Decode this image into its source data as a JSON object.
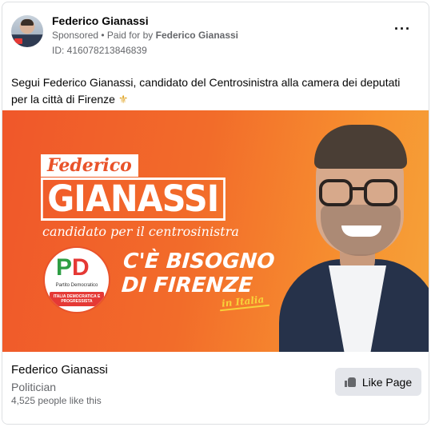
{
  "post": {
    "author": "Federico Gianassi",
    "sponsored": "Sponsored",
    "paid_for_prefix": " • Paid for by ",
    "paid_for_name": "Federico Gianassi",
    "ad_id": "ID: 416078213846839",
    "more_icon": "···",
    "caption": "Segui Federico Gianassi, candidato del Centrosinistra alla camera dei deputati per la città di Firenze",
    "caption_emoji": "⚜"
  },
  "banner": {
    "first_name": "Federico",
    "last_name": "GIANASSI",
    "subtitle": "candidato per il centrosinistra",
    "slogan_line1": "C'È BISOGNO",
    "slogan_line2": "DI FIRENZE",
    "slogan_tag": "in Italia",
    "pd_logo": {
      "letters_p": "P",
      "letters_d": "D",
      "sub": "Partito Democratico",
      "band": "ITALIA DEMOCRATICA E PROGRESSISTA"
    }
  },
  "footer": {
    "page_name": "Federico Gianassi",
    "category": "Politician",
    "likes": "4,525 people like this",
    "like_button": "Like Page"
  }
}
